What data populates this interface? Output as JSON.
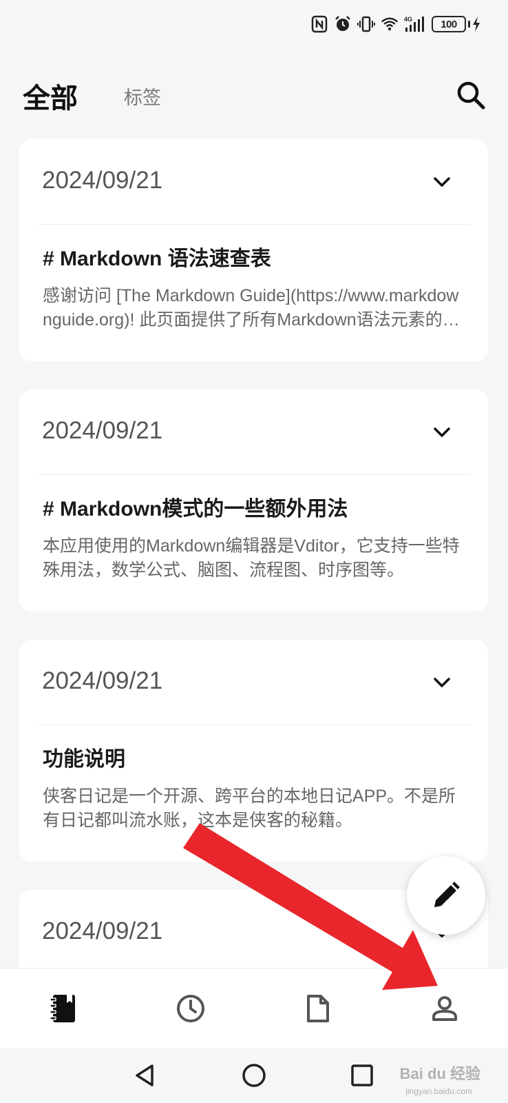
{
  "status_bar": {
    "battery_level": "100",
    "network_label": "4G"
  },
  "header": {
    "tab_all": "全部",
    "tab_tags": "标签"
  },
  "notes": [
    {
      "date": "2024/09/21",
      "title": "# Markdown 语法速查表",
      "excerpt": "感谢访问 [The Markdown Guide](https://www.markdownguide.org)! 此页面提供了所有Markdown语法元素的基本概述。"
    },
    {
      "date": "2024/09/21",
      "title": "# Markdown模式的一些额外用法",
      "excerpt": "本应用使用的Markdown编辑器是Vditor，它支持一些特殊用法，数学公式、脑图、流程图、时序图等。"
    },
    {
      "date": "2024/09/21",
      "title": "功能说明",
      "excerpt": "侠客日记是一个开源、跨平台的本地日记APP。不是所有日记都叫流水账，这本是侠客的秘籍。"
    },
    {
      "date": "2024/09/21",
      "title": "",
      "excerpt": ""
    }
  ],
  "colors": {
    "background": "#f5f6f8",
    "card": "#ffffff",
    "accent_arrow": "#e8262b"
  },
  "icons": {
    "search": "search-icon",
    "chevron": "chevron-down-icon",
    "fab": "edit-pencil-icon",
    "nav": [
      "diary-book-icon",
      "clock-icon",
      "document-icon",
      "person-icon"
    ],
    "system": [
      "back-triangle-icon",
      "home-circle-icon",
      "recents-square-icon"
    ]
  },
  "watermark": {
    "brand": "Bai du 经验",
    "sub": "jingyan.baidu.com"
  }
}
